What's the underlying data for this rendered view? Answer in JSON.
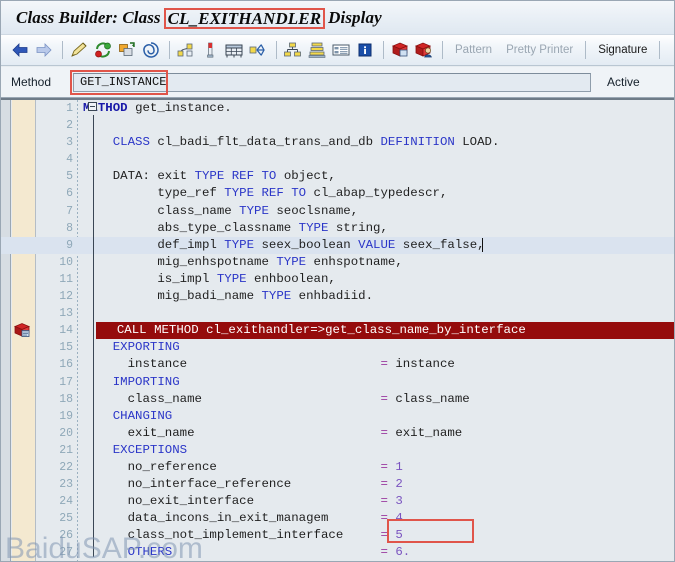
{
  "window": {
    "title_prefix": "Class Builder: Class",
    "title_highlight": "CL_EXITHANDLER",
    "title_suffix": "Display"
  },
  "toolbar": {
    "icons": [
      {
        "name": "back-arrow-icon",
        "label": "Back"
      },
      {
        "name": "forward-arrow-icon",
        "label": "Forward"
      },
      {
        "name": "pencil-check-icon",
        "label": "Check"
      },
      {
        "name": "activate-icon",
        "label": "Activate"
      },
      {
        "name": "copy-object-icon",
        "label": "Copy"
      },
      {
        "name": "spiral-icon",
        "label": "Where-Used List"
      },
      {
        "name": "navigation-graph-icon",
        "label": "Display Object List"
      },
      {
        "name": "breakpoint-icon",
        "label": "Set Breakpoint"
      },
      {
        "name": "table-icon",
        "label": "Display Structure"
      },
      {
        "name": "expand-arrows-icon",
        "label": "Expand"
      },
      {
        "name": "class-hierarchy-icon",
        "label": "Class Hierarchy"
      },
      {
        "name": "inheritance-icon",
        "label": "Inheritance"
      },
      {
        "name": "list-icon",
        "label": "List"
      },
      {
        "name": "info-icon",
        "label": "Information"
      },
      {
        "name": "package-icon",
        "label": "Package Builder"
      },
      {
        "name": "user-object-icon",
        "label": "User Objects"
      }
    ],
    "buttons": [
      {
        "name": "pattern-button",
        "label": "Pattern",
        "enabled": false
      },
      {
        "name": "pretty-printer-button",
        "label": "Pretty Printer",
        "enabled": false
      },
      {
        "name": "signature-button",
        "label": "Signature",
        "enabled": true
      }
    ]
  },
  "method_bar": {
    "label": "Method",
    "value": "GET_INSTANCE",
    "placeholder": "",
    "status": "Active"
  },
  "editor": {
    "watermark": "BaiduSAP.com",
    "highlight_boxes": [
      {
        "name": "exit-name-highlight",
        "line": 20
      }
    ],
    "cursor": {
      "line": 9,
      "column": 48
    },
    "breakpoint_line": 14,
    "error_line": 14,
    "lines": [
      {
        "n": 1,
        "text": "METHOD get_instance."
      },
      {
        "n": 2,
        "text": ""
      },
      {
        "n": 3,
        "text": "    CLASS cl_badi_flt_data_trans_and_db DEFINITION LOAD."
      },
      {
        "n": 4,
        "text": ""
      },
      {
        "n": 5,
        "text": "    DATA: exit TYPE REF TO object,"
      },
      {
        "n": 6,
        "text": "          type_ref TYPE REF TO cl_abap_typedescr,"
      },
      {
        "n": 7,
        "text": "          class_name TYPE seoclsname,"
      },
      {
        "n": 8,
        "text": "          abs_type_classname TYPE string,"
      },
      {
        "n": 9,
        "text": "          def_impl TYPE seex_boolean VALUE seex_false,"
      },
      {
        "n": 10,
        "text": "          mig_enhspotname TYPE enhspotname,"
      },
      {
        "n": 11,
        "text": "          is_impl TYPE enhboolean,"
      },
      {
        "n": 12,
        "text": "          mig_badi_name TYPE enhbadiid."
      },
      {
        "n": 13,
        "text": ""
      },
      {
        "n": 14,
        "text": "  CALL METHOD cl_exithandler=>get_class_name_by_interface"
      },
      {
        "n": 15,
        "text": "    EXPORTING"
      },
      {
        "n": 16,
        "text": "      instance                          = instance"
      },
      {
        "n": 17,
        "text": "    IMPORTING"
      },
      {
        "n": 18,
        "text": "      class_name                        = class_name"
      },
      {
        "n": 19,
        "text": "    CHANGING"
      },
      {
        "n": 20,
        "text": "      exit_name                         = exit_name"
      },
      {
        "n": 21,
        "text": "    EXCEPTIONS"
      },
      {
        "n": 22,
        "text": "      no_reference                      = 1"
      },
      {
        "n": 23,
        "text": "      no_interface_reference            = 2"
      },
      {
        "n": 24,
        "text": "      no_exit_interface                 = 3"
      },
      {
        "n": 25,
        "text": "      data_incons_in_exit_managem       = 4"
      },
      {
        "n": 26,
        "text": "      class_not_implement_interface     = 5"
      },
      {
        "n": 27,
        "text": "      OTHERS                            = 6."
      }
    ]
  },
  "colors": {
    "highlight_red": "#e0554a",
    "error_bar": "#950c0c",
    "keyword_blue": "#2b36c8",
    "number_purple": "#7b55c0",
    "cursor_line": "#dae3ef"
  }
}
